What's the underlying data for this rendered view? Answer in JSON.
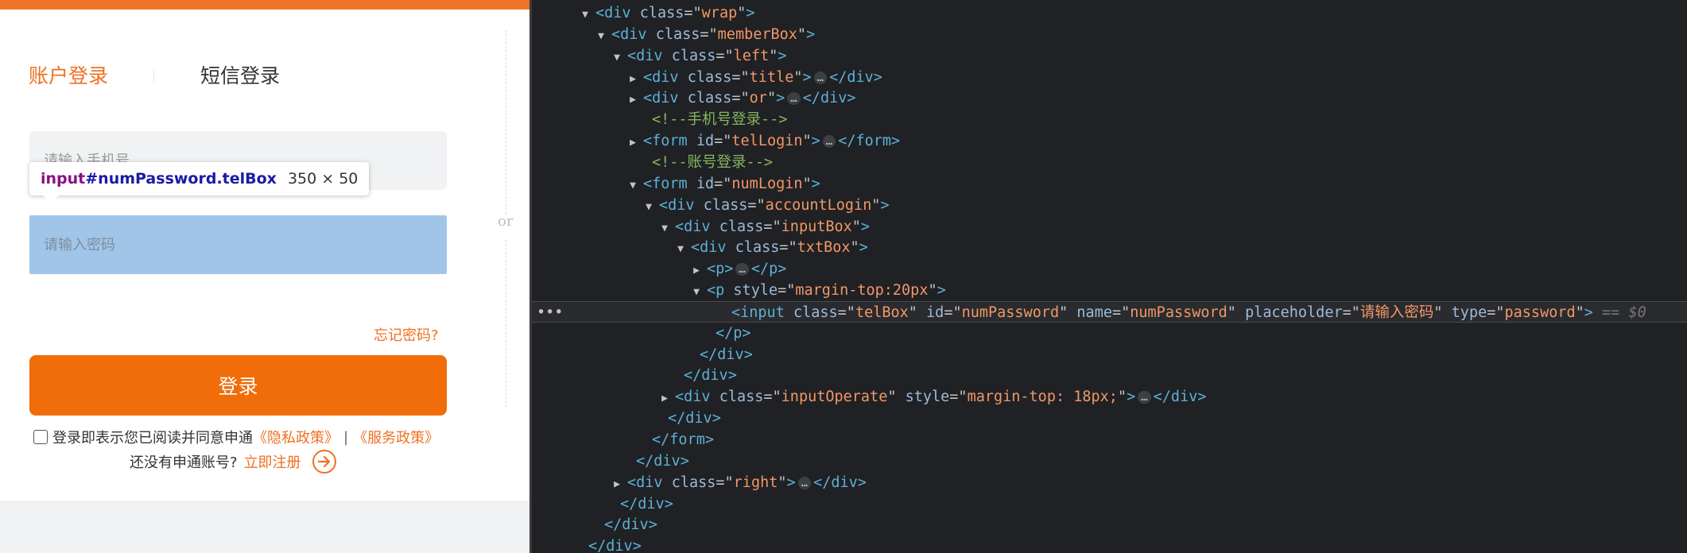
{
  "login": {
    "tab_account": "账户登录",
    "tab_sms": "短信登录",
    "phone_placeholder": "请输入手机号",
    "password_placeholder": "请输入密码",
    "or_text": "or",
    "forgot_password": "忘记密码?",
    "login_button": "登录",
    "agree_text": "登录即表示您已阅读并同意申通",
    "privacy_link": "《隐私政策》",
    "separator": "|",
    "service_link": "《服务政策》",
    "register_prompt": "还没有申通账号?",
    "register_link": "立即注册"
  },
  "tooltip": {
    "tag": "input",
    "id_class": "#numPassword.telBox",
    "size": "350 × 50"
  },
  "devtools": {
    "selected_marker": "•••",
    "lines": [
      {
        "tri": "▼",
        "tag": "div",
        "attrs": [
          {
            "n": "class",
            "v": "wrap"
          }
        ],
        "mode": "open"
      },
      {
        "tri": "▼",
        "tag": "div",
        "attrs": [
          {
            "n": "class",
            "v": "memberBox"
          }
        ],
        "mode": "open"
      },
      {
        "tri": "▼",
        "tag": "div",
        "attrs": [
          {
            "n": "class",
            "v": "left"
          }
        ],
        "mode": "open"
      },
      {
        "tri": "▶",
        "tag": "div",
        "attrs": [
          {
            "n": "class",
            "v": "title"
          }
        ],
        "mode": "collapsed"
      },
      {
        "tri": "▶",
        "tag": "div",
        "attrs": [
          {
            "n": "class",
            "v": "or"
          }
        ],
        "mode": "collapsed"
      },
      {
        "tri": "",
        "comment": "<!--手机号登录-->",
        "mode": "comment"
      },
      {
        "tri": "▶",
        "tag": "form",
        "attrs": [
          {
            "n": "id",
            "v": "telLogin"
          }
        ],
        "mode": "collapsed"
      },
      {
        "tri": "",
        "comment": "<!--账号登录-->",
        "mode": "comment"
      },
      {
        "tri": "▼",
        "tag": "form",
        "attrs": [
          {
            "n": "id",
            "v": "numLogin"
          }
        ],
        "mode": "open"
      },
      {
        "tri": "▼",
        "tag": "div",
        "attrs": [
          {
            "n": "class",
            "v": "accountLogin"
          }
        ],
        "mode": "open"
      },
      {
        "tri": "▼",
        "tag": "div",
        "attrs": [
          {
            "n": "class",
            "v": "inputBox"
          }
        ],
        "mode": "open"
      },
      {
        "tri": "▼",
        "tag": "div",
        "attrs": [
          {
            "n": "class",
            "v": "txtBox"
          }
        ],
        "mode": "open"
      },
      {
        "tri": "▶",
        "tag": "p",
        "attrs": [],
        "mode": "collapsed"
      },
      {
        "tri": "▼",
        "tag": "p",
        "attrs": [
          {
            "n": "style",
            "v": "margin-top:20px"
          }
        ],
        "mode": "open"
      },
      {
        "tri": "",
        "tag": "input",
        "attrs": [
          {
            "n": "class",
            "v": "telBox"
          },
          {
            "n": "id",
            "v": "numPassword"
          },
          {
            "n": "name",
            "v": "numPassword"
          },
          {
            "n": "placeholder",
            "v": "请输入密码"
          },
          {
            "n": "type",
            "v": "password"
          }
        ],
        "mode": "open",
        "selected": true,
        "suffix": "== $0"
      },
      {
        "tri": "",
        "tag": "p",
        "mode": "close"
      },
      {
        "tri": "",
        "tag": "div",
        "mode": "close"
      },
      {
        "tri": "",
        "tag": "div",
        "mode": "close"
      },
      {
        "tri": "▶",
        "tag": "div",
        "attrs": [
          {
            "n": "class",
            "v": "inputOperate"
          },
          {
            "n": "style",
            "v": "margin-top: 18px;"
          }
        ],
        "mode": "collapsed"
      },
      {
        "tri": "",
        "tag": "div",
        "mode": "close"
      },
      {
        "tri": "",
        "tag": "form",
        "mode": "close"
      },
      {
        "tri": "",
        "tag": "div",
        "mode": "close"
      },
      {
        "tri": "▶",
        "tag": "div",
        "attrs": [
          {
            "n": "class",
            "v": "right"
          }
        ],
        "mode": "collapsed"
      },
      {
        "tri": "",
        "tag": "div",
        "mode": "close"
      },
      {
        "tri": "",
        "tag": "div",
        "mode": "close"
      },
      {
        "tri": "",
        "tag": "div",
        "mode": "close"
      }
    ]
  }
}
